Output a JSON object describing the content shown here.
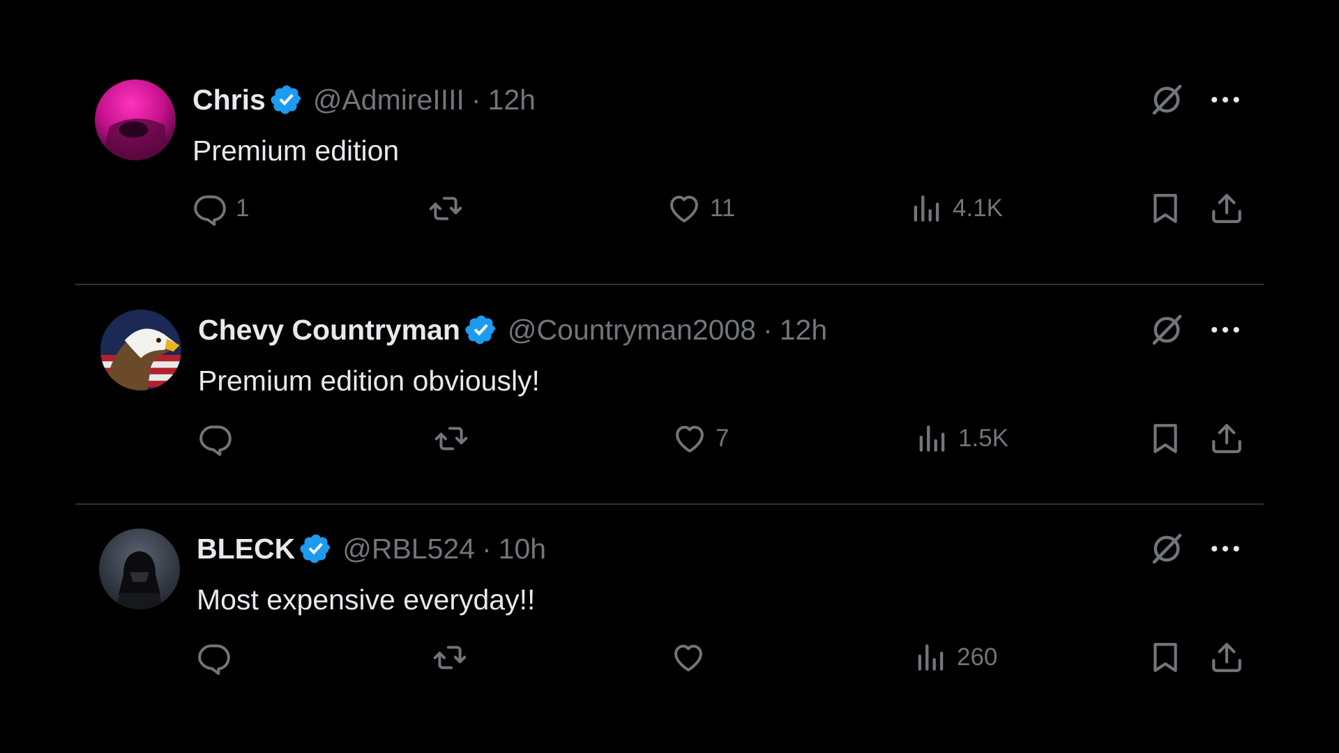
{
  "colors": {
    "background": "#000000",
    "primary_text": "#e7e9ea",
    "secondary_text": "#71767b",
    "verified_blue": "#1d9bf0",
    "divider": "#2f3336"
  },
  "icons": {
    "verified": "verified-badge-icon",
    "grok": "grok-icon",
    "more": "more-options-icon",
    "reply": "reply-icon",
    "repost": "repost-icon",
    "like": "heart-icon",
    "views": "views-chart-icon",
    "bookmark": "bookmark-icon",
    "share": "share-icon"
  },
  "tweets": [
    {
      "name": "Chris",
      "handle": "@AdmireIIII",
      "separator": "·",
      "time": "12h",
      "text": "Premium edition",
      "replies": "1",
      "reposts": "",
      "likes": "11",
      "views": "4.1K"
    },
    {
      "name": "Chevy Countryman",
      "handle": "@Countryman2008",
      "separator": "·",
      "time": "12h",
      "text": "Premium edition obviously!",
      "replies": "",
      "reposts": "",
      "likes": "7",
      "views": "1.5K"
    },
    {
      "name": "BLECK",
      "handle": "@RBL524",
      "separator": "·",
      "time": "10h",
      "text": "Most expensive everyday!!",
      "replies": "",
      "reposts": "",
      "likes": "",
      "views": "260"
    }
  ]
}
